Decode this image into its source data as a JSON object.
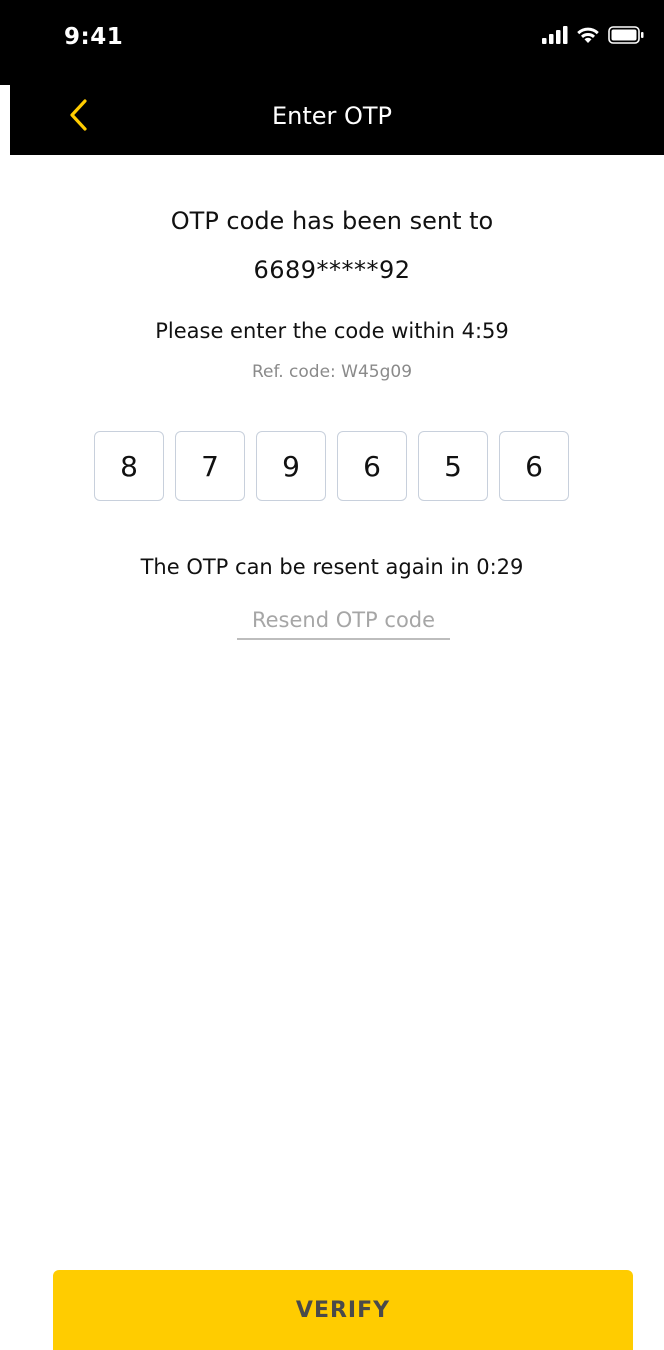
{
  "status_bar": {
    "time": "9:41",
    "icons": [
      "signal-icon",
      "wifi-icon",
      "battery-icon"
    ]
  },
  "nav": {
    "title": "Enter OTP",
    "back_icon": "chevron-left-icon",
    "accent_color": "#FFCC00"
  },
  "otp_info": {
    "sent_text": "OTP code has been sent to",
    "phone": "6689*****92",
    "within_text": "Please enter the code within 4:59",
    "ref_text": "Ref. code: W45g09"
  },
  "otp_digits": [
    "8",
    "7",
    "9",
    "6",
    "5",
    "6"
  ],
  "resend": {
    "info_text": "The OTP can be resent again in 0:29",
    "link_label": "Resend OTP code"
  },
  "verify": {
    "label": "VERIFY",
    "color": "#FFCC00"
  }
}
